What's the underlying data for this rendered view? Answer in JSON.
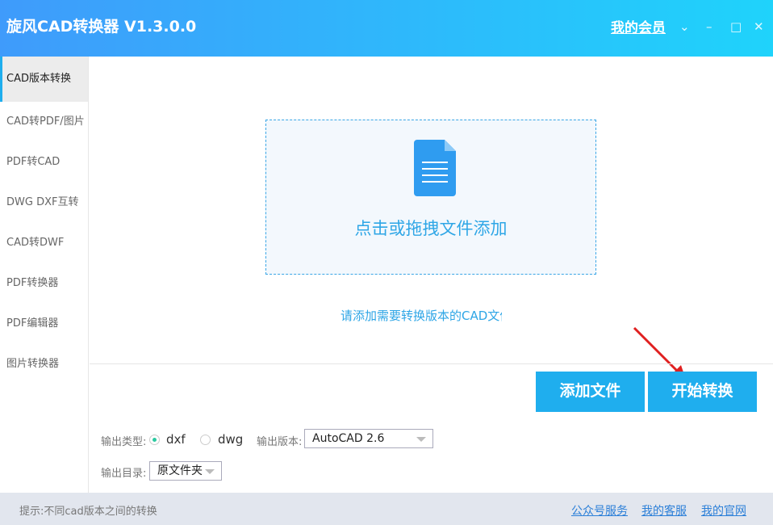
{
  "app": {
    "title": "旋风CAD转换器 V1.3.0.0",
    "member": "我的会员"
  },
  "sidebar": {
    "items": [
      {
        "label": "CAD版本转换"
      },
      {
        "label": "CAD转PDF/图片"
      },
      {
        "label": "PDF转CAD"
      },
      {
        "label": "DWG DXF互转"
      },
      {
        "label": "CAD转DWF"
      },
      {
        "label": "PDF转换器"
      },
      {
        "label": "PDF编辑器"
      },
      {
        "label": "图片转换器"
      }
    ]
  },
  "main": {
    "drop_text": "点击或拖拽文件添加",
    "hint": "请添加需要转换版本的CAD文件",
    "add_button": "添加文件",
    "start_button": "开始转换"
  },
  "options": {
    "type_label": "输出类型:",
    "type_options": [
      "dxf",
      "dwg"
    ],
    "version_label": "输出版本:",
    "version_value": "AutoCAD 2.6",
    "dir_label": "输出目录:",
    "dir_value": "原文件夹"
  },
  "footer": {
    "tip": "提示:不同cad版本之间的转换",
    "links": [
      "公众号服务",
      "我的客服",
      "我的官网"
    ]
  }
}
